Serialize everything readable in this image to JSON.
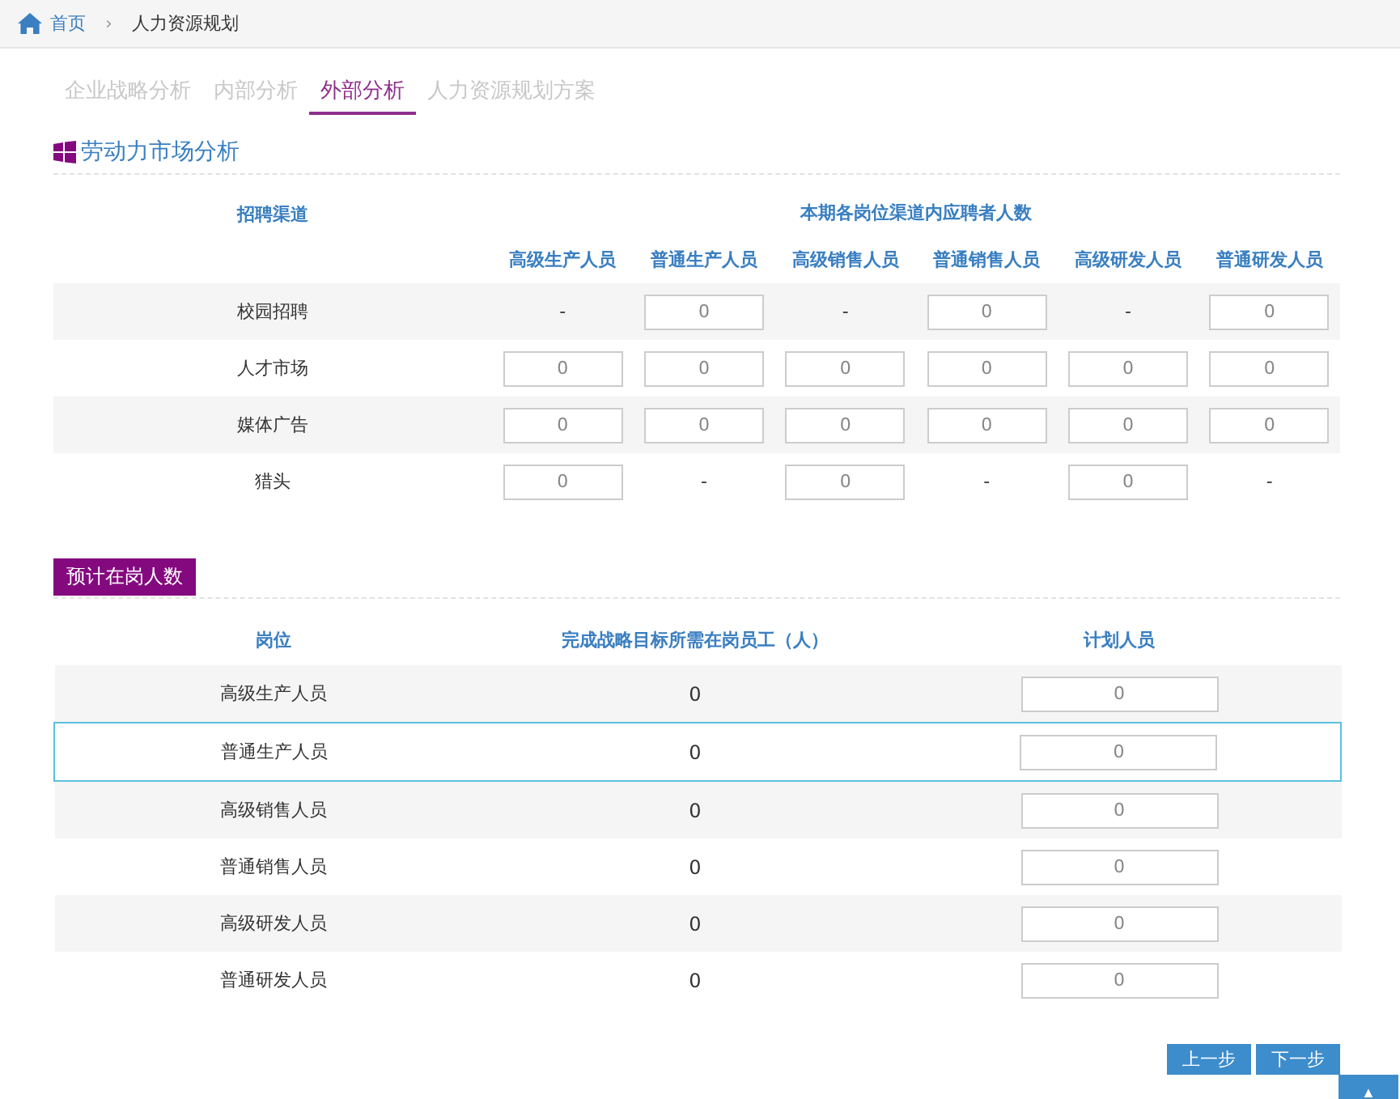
{
  "breadcrumb": {
    "home": "首页",
    "separator": "›",
    "current": "人力资源规划"
  },
  "tabs": [
    {
      "label": "企业战略分析",
      "selected": false
    },
    {
      "label": "内部分析",
      "selected": false
    },
    {
      "label": "外部分析",
      "selected": true
    },
    {
      "label": "人力资源规划方案",
      "selected": false
    }
  ],
  "market": {
    "title": "劳动力市场分析",
    "channel_header": "招聘渠道",
    "group_header": "本期各岗位渠道内应聘者人数",
    "columns": [
      "高级生产人员",
      "普通生产人员",
      "高级销售人员",
      "普通销售人员",
      "高级研发人员",
      "普通研发人员"
    ],
    "rows": [
      {
        "channel": "校园招聘",
        "cells": [
          {
            "kind": "dash",
            "text": "-"
          },
          {
            "kind": "input",
            "value": "0"
          },
          {
            "kind": "dash",
            "text": "-"
          },
          {
            "kind": "input",
            "value": "0"
          },
          {
            "kind": "dash",
            "text": "-"
          },
          {
            "kind": "input",
            "value": "0"
          }
        ]
      },
      {
        "channel": "人才市场",
        "cells": [
          {
            "kind": "input",
            "value": "0"
          },
          {
            "kind": "input",
            "value": "0"
          },
          {
            "kind": "input",
            "value": "0"
          },
          {
            "kind": "input",
            "value": "0"
          },
          {
            "kind": "input",
            "value": "0"
          },
          {
            "kind": "input",
            "value": "0"
          }
        ]
      },
      {
        "channel": "媒体广告",
        "cells": [
          {
            "kind": "input",
            "value": "0"
          },
          {
            "kind": "input",
            "value": "0"
          },
          {
            "kind": "input",
            "value": "0"
          },
          {
            "kind": "input",
            "value": "0"
          },
          {
            "kind": "input",
            "value": "0"
          },
          {
            "kind": "input",
            "value": "0"
          }
        ]
      },
      {
        "channel": "猎头",
        "cells": [
          {
            "kind": "input",
            "value": "0"
          },
          {
            "kind": "dash",
            "text": "-"
          },
          {
            "kind": "input",
            "value": "0"
          },
          {
            "kind": "dash",
            "text": "-"
          },
          {
            "kind": "input",
            "value": "0"
          },
          {
            "kind": "dash",
            "text": "-"
          }
        ]
      }
    ]
  },
  "staffing": {
    "title": "预计在岗人数",
    "columns": [
      "岗位",
      "完成战略目标所需在岗员工（人）",
      "计划人员"
    ],
    "rows": [
      {
        "position": "高级生产人员",
        "required": "0",
        "planned": "0",
        "selected": false
      },
      {
        "position": "普通生产人员",
        "required": "0",
        "planned": "0",
        "selected": true
      },
      {
        "position": "高级销售人员",
        "required": "0",
        "planned": "0",
        "selected": false
      },
      {
        "position": "普通销售人员",
        "required": "0",
        "planned": "0",
        "selected": false
      },
      {
        "position": "高级研发人员",
        "required": "0",
        "planned": "0",
        "selected": false
      },
      {
        "position": "普通研发人员",
        "required": "0",
        "planned": "0",
        "selected": false
      }
    ]
  },
  "buttons": [
    "上一步",
    "下一步"
  ],
  "scroll_top": "▲"
}
